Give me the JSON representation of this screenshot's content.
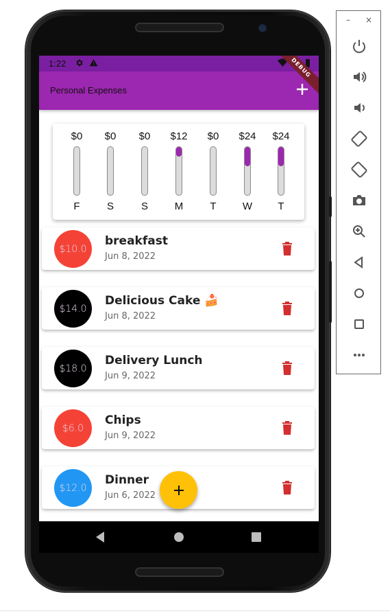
{
  "status_bar": {
    "time": "1:22",
    "icons": [
      "settings-icon",
      "alert-icon",
      "wifi-icon",
      "battery-icon"
    ]
  },
  "app_bar": {
    "title": "Personal Expenses",
    "add_icon": "plus-icon",
    "debug_label": "DEBUG"
  },
  "chart": {
    "bars": [
      {
        "day": "F",
        "amount_label": "$0",
        "fill_fraction": 0.0
      },
      {
        "day": "S",
        "amount_label": "$0",
        "fill_fraction": 0.0
      },
      {
        "day": "S",
        "amount_label": "$0",
        "fill_fraction": 0.0
      },
      {
        "day": "M",
        "amount_label": "$12",
        "fill_fraction": 0.2
      },
      {
        "day": "T",
        "amount_label": "$0",
        "fill_fraction": 0.0
      },
      {
        "day": "W",
        "amount_label": "$24",
        "fill_fraction": 0.4
      },
      {
        "day": "T",
        "amount_label": "$24",
        "fill_fraction": 0.4
      }
    ]
  },
  "transactions": [
    {
      "amount": "$10.0",
      "title": "breakfast",
      "date": "Jun 8, 2022",
      "avatar_color": "#f44336"
    },
    {
      "amount": "$14.0",
      "title": "Delicious Cake 🍰",
      "date": "Jun 8, 2022",
      "avatar_color": "#000000"
    },
    {
      "amount": "$18.0",
      "title": "Delivery Lunch",
      "date": "Jun 9, 2022",
      "avatar_color": "#000000"
    },
    {
      "amount": "$6.0",
      "title": "Chips",
      "date": "Jun 9, 2022",
      "avatar_color": "#f44336"
    },
    {
      "amount": "$12.0",
      "title": "Dinner",
      "date": "Jun 6, 2022",
      "avatar_color": "#2196f3"
    }
  ],
  "colors": {
    "primary": "#9c27b0",
    "status": "#7b1fa2",
    "accent": "#ffc107",
    "delete": "#d32f2f"
  },
  "fab": {
    "icon": "plus-icon"
  },
  "nav_bar": {
    "buttons": [
      "back-icon",
      "home-icon",
      "recents-icon"
    ]
  },
  "emulator_toolbar": {
    "window_controls": {
      "minimize": "–",
      "close": "×"
    },
    "tools": [
      "power-icon",
      "volume-up-icon",
      "volume-down-icon",
      "rotate-left-icon",
      "rotate-right-icon",
      "camera-icon",
      "zoom-icon",
      "back-icon",
      "home-icon",
      "overview-icon",
      "more-icon"
    ]
  }
}
